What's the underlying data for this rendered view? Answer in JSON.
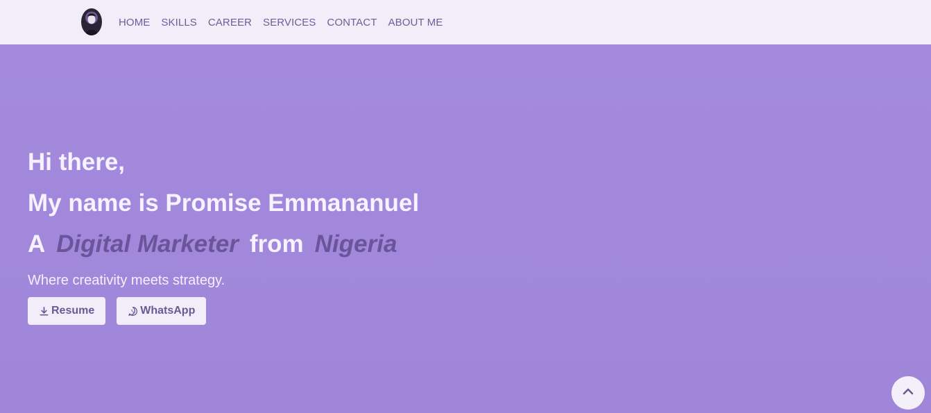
{
  "nav": {
    "items": [
      {
        "label": "HOME"
      },
      {
        "label": "SKILLS"
      },
      {
        "label": "CAREER"
      },
      {
        "label": "SERVICES"
      },
      {
        "label": "CONTACT"
      },
      {
        "label": "ABOUT ME"
      }
    ]
  },
  "hero": {
    "greeting": "Hi there,",
    "name_line": "My name is Promise Emmananuel",
    "role_prefix": "A",
    "role": "Digital Marketer",
    "from_word": "from",
    "country": "Nigeria",
    "tagline": "Where creativity meets strategy.",
    "resume_label": "Resume",
    "whatsapp_label": "WhatsApp"
  },
  "icons": {
    "resume": "download-icon",
    "whatsapp": "whatsapp-icon",
    "scroll_top": "chevron-up-icon"
  },
  "colors": {
    "nav_bg": "#f1eef9",
    "hero_bg": "#a38ade",
    "nav_text": "#6e5c97",
    "accent_text": "#6b559a",
    "hero_text": "#f6f2ff"
  }
}
